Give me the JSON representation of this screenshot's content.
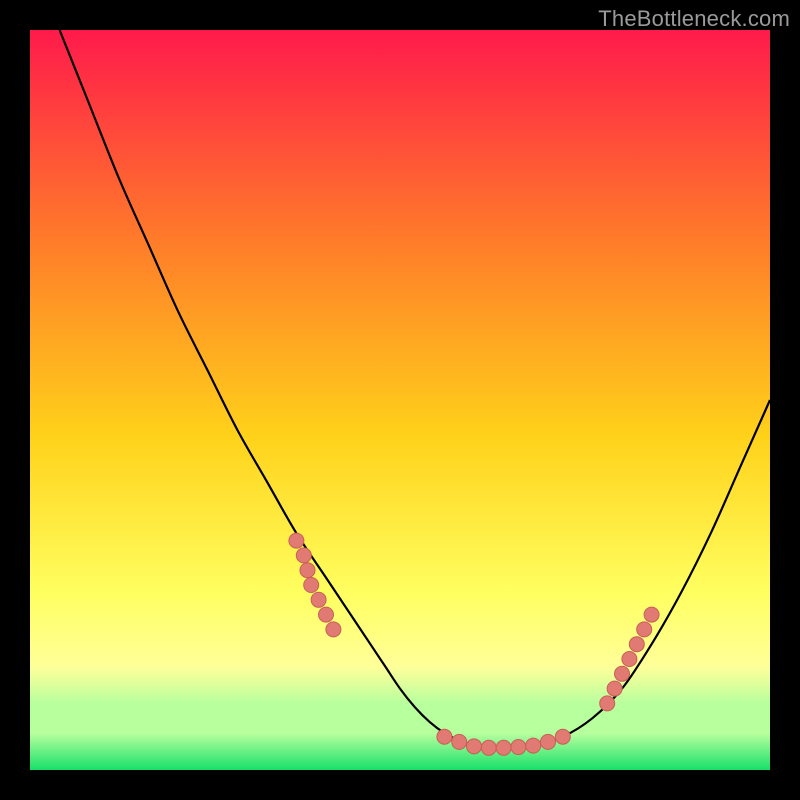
{
  "watermark": "TheBottleneck.com",
  "colors": {
    "bg": "#000000",
    "grad_top": "#ff1a4b",
    "grad_mid1": "#ff7a2a",
    "grad_mid2": "#ffd21a",
    "grad_low": "#ffff60",
    "grad_band_yellow": "#ffff99",
    "grad_green_pale": "#b8ff9e",
    "grad_green": "#18e06a",
    "curve": "#000000",
    "marker_fill": "#e07a72",
    "marker_stroke": "#c85f56"
  },
  "chart_data": {
    "type": "line",
    "title": "",
    "xlabel": "",
    "ylabel": "",
    "xlim": [
      0,
      100
    ],
    "ylim": [
      0,
      100
    ],
    "curve": {
      "name": "bottleneck-curve",
      "x": [
        4,
        8,
        12,
        16,
        20,
        24,
        28,
        32,
        36,
        40,
        44,
        46,
        48,
        50,
        52,
        54,
        56,
        58,
        60,
        62,
        64,
        68,
        72,
        76,
        80,
        84,
        88,
        92,
        96,
        100
      ],
      "y": [
        100,
        90,
        80,
        71,
        62,
        54,
        46,
        39,
        32,
        26,
        20,
        17,
        14,
        11,
        8.5,
        6.5,
        5,
        4,
        3.3,
        3.0,
        3.0,
        3.3,
        4.5,
        7,
        11,
        17,
        24,
        32,
        41,
        50
      ]
    },
    "markers": [
      {
        "name": "left-cluster",
        "points": [
          {
            "x": 36,
            "y": 31
          },
          {
            "x": 37,
            "y": 29
          },
          {
            "x": 37.5,
            "y": 27
          },
          {
            "x": 38,
            "y": 25
          },
          {
            "x": 39,
            "y": 23
          },
          {
            "x": 40,
            "y": 21
          },
          {
            "x": 41,
            "y": 19
          }
        ]
      },
      {
        "name": "trough-cluster",
        "points": [
          {
            "x": 56,
            "y": 4.5
          },
          {
            "x": 58,
            "y": 3.8
          },
          {
            "x": 60,
            "y": 3.2
          },
          {
            "x": 62,
            "y": 3.0
          },
          {
            "x": 64,
            "y": 3.0
          },
          {
            "x": 66,
            "y": 3.1
          },
          {
            "x": 68,
            "y": 3.3
          },
          {
            "x": 70,
            "y": 3.8
          },
          {
            "x": 72,
            "y": 4.5
          }
        ]
      },
      {
        "name": "right-cluster",
        "points": [
          {
            "x": 78,
            "y": 9
          },
          {
            "x": 79,
            "y": 11
          },
          {
            "x": 80,
            "y": 13
          },
          {
            "x": 81,
            "y": 15
          },
          {
            "x": 82,
            "y": 17
          },
          {
            "x": 83,
            "y": 19
          },
          {
            "x": 84,
            "y": 21
          }
        ]
      }
    ]
  }
}
